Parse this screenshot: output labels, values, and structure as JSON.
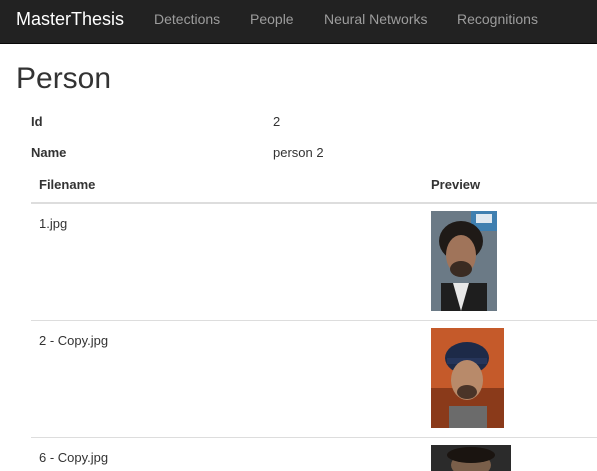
{
  "navbar": {
    "brand": "MasterThesis",
    "links": [
      "Detections",
      "People",
      "Neural Networks",
      "Recognitions"
    ]
  },
  "page": {
    "title": "Person"
  },
  "details": {
    "id_label": "Id",
    "id_value": "2",
    "name_label": "Name",
    "name_value": "person 2"
  },
  "table": {
    "columns": [
      "Filename",
      "Preview"
    ],
    "rows": [
      {
        "filename": "1.jpg"
      },
      {
        "filename": "2 - Copy.jpg"
      },
      {
        "filename": "6 - Copy.jpg"
      }
    ]
  },
  "colors": {
    "navbar_bg": "#222222",
    "brand": "#ffffff",
    "nav_link": "#9d9d9d",
    "text": "#333333",
    "divider": "#dddddd"
  }
}
